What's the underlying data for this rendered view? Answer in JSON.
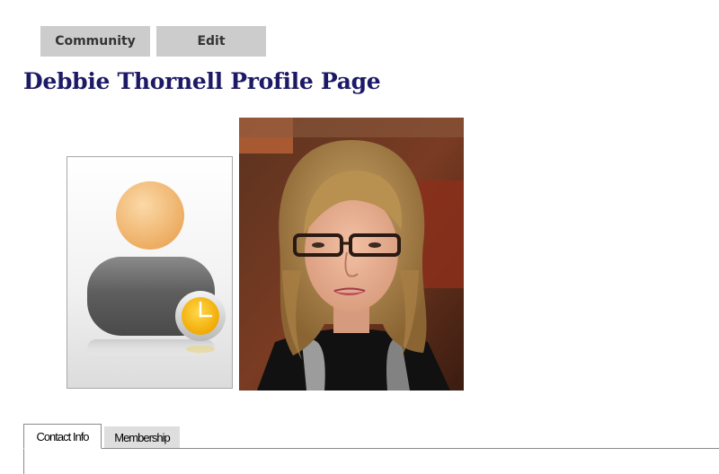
{
  "nav": {
    "community_label": "Community",
    "edit_label": "Edit"
  },
  "profile": {
    "title": "Debbie Thornell Profile Page"
  },
  "tabs": [
    {
      "label": "Contact Info",
      "active": true
    },
    {
      "label": "Membership",
      "active": false
    }
  ],
  "colors": {
    "title": "#1c1a66",
    "nav_button_bg": "#cccccc",
    "clock_accent": "#f5b800"
  },
  "icons": {
    "placeholder": "user-pending-clock-icon"
  }
}
